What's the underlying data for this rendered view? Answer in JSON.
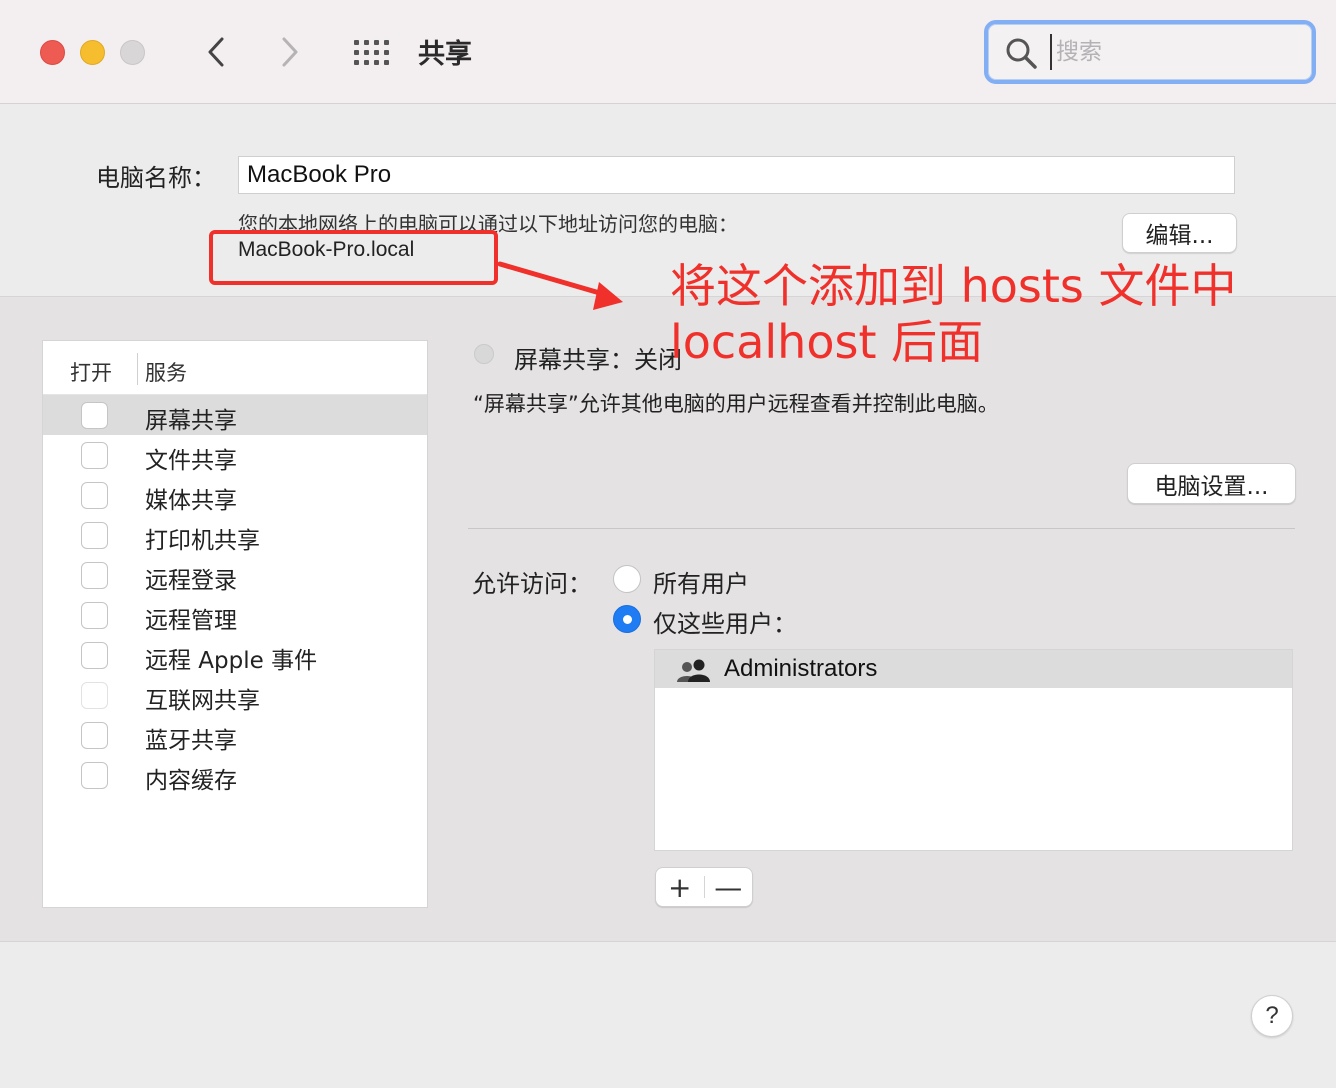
{
  "window": {
    "title": "共享"
  },
  "search": {
    "placeholder": "搜索"
  },
  "computer_name": {
    "label": "电脑名称：",
    "value": "MacBook Pro",
    "address_desc": "您的本地网络上的电脑可以通过以下地址访问您的电脑：",
    "address": "MacBook-Pro.local",
    "edit_label": "编辑..."
  },
  "services": {
    "header_open": "打开",
    "header_service": "服务",
    "items": [
      {
        "label": "屏幕共享",
        "checked": false,
        "selected": true
      },
      {
        "label": "文件共享",
        "checked": false
      },
      {
        "label": "媒体共享",
        "checked": false
      },
      {
        "label": "打印机共享",
        "checked": false
      },
      {
        "label": "远程登录",
        "checked": false
      },
      {
        "label": "远程管理",
        "checked": false
      },
      {
        "label": "远程 Apple 事件",
        "checked": false
      },
      {
        "label": "互联网共享",
        "checked": false,
        "disabled": true
      },
      {
        "label": "蓝牙共享",
        "checked": false
      },
      {
        "label": "内容缓存",
        "checked": false
      }
    ]
  },
  "detail": {
    "status": "屏幕共享：关闭",
    "description": "“屏幕共享”允许其他电脑的用户远程查看并控制此电脑。",
    "settings_label": "电脑设置...",
    "access_label": "允许访问：",
    "option_all": "所有用户",
    "option_some": "仅这些用户：",
    "selected_option": "some",
    "users": [
      "Administrators"
    ],
    "add_label": "+",
    "remove_label": "—"
  },
  "help": {
    "label": "?"
  },
  "annotation": {
    "line1": "将这个添加到 hosts 文件中",
    "line2": "localhost 后面",
    "color": "#f0302a"
  },
  "colors": {
    "accent": "#1f7cf2",
    "annotation": "#f0302a"
  }
}
